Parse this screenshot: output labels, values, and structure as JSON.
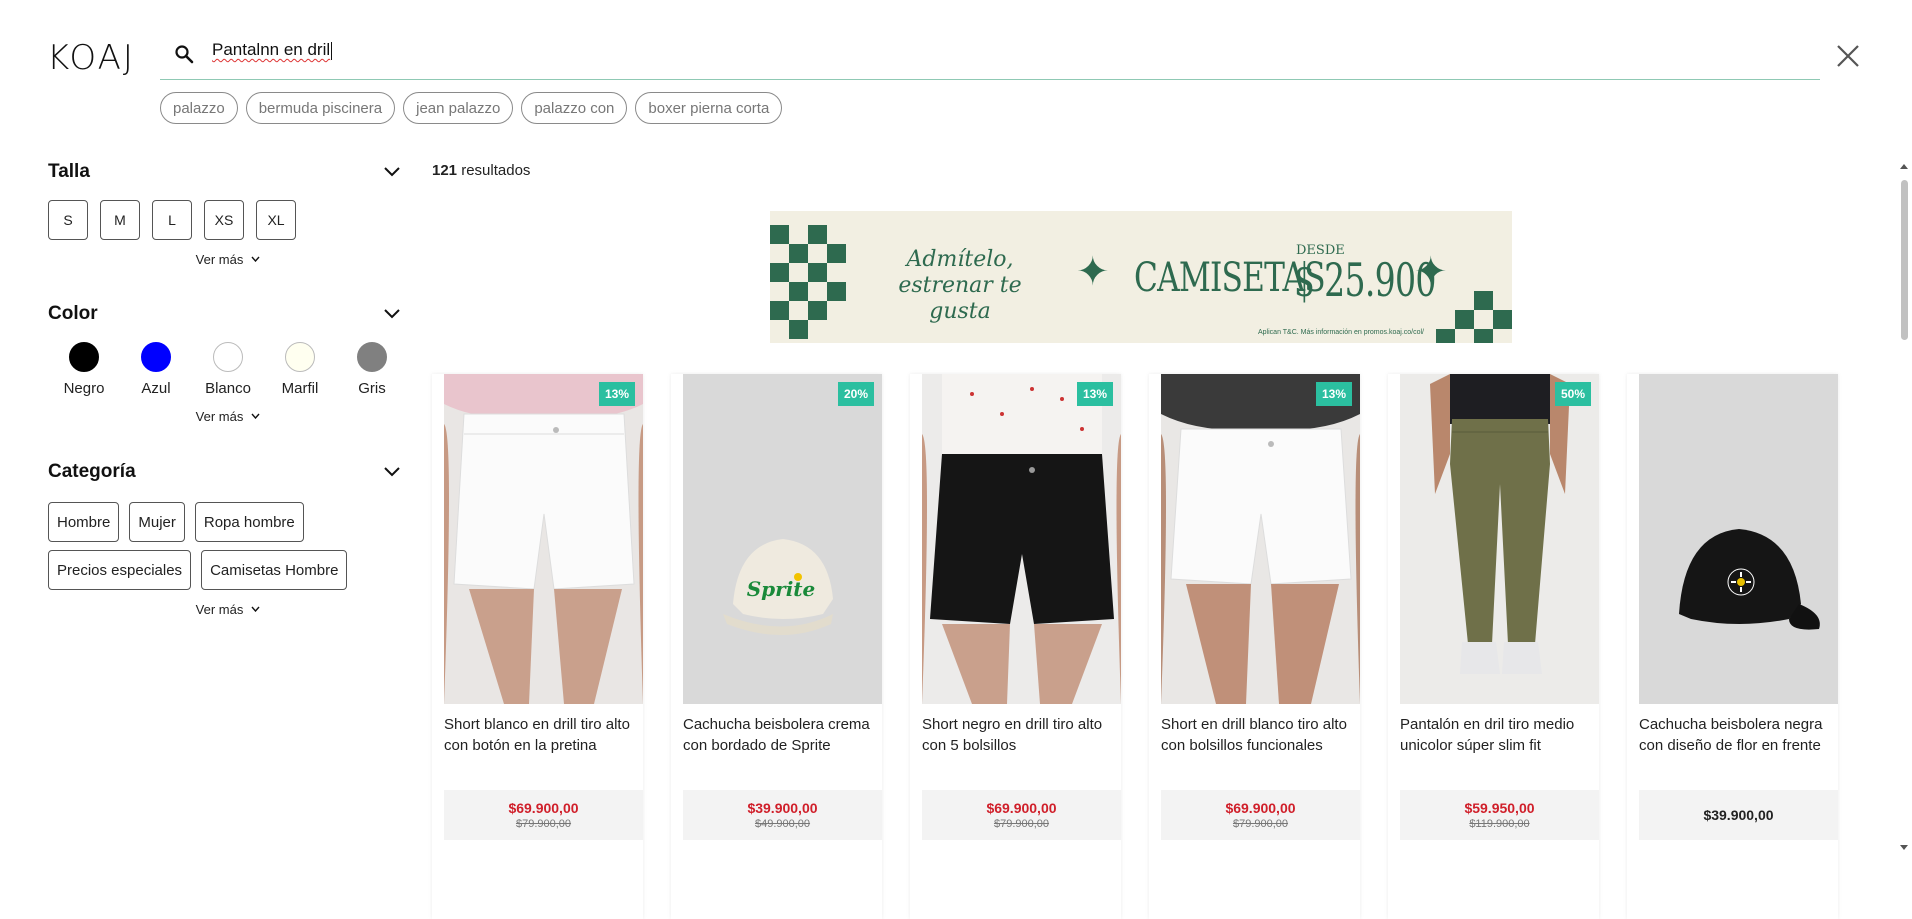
{
  "header": {
    "logo": "KOAJ",
    "search_value": "Pantalnn en dril",
    "suggestions": [
      "palazzo",
      "bermuda piscinera",
      "jean palazzo",
      "palazzo con",
      "boxer pierna corta"
    ]
  },
  "filters": {
    "talla": {
      "title": "Talla",
      "options": [
        "S",
        "M",
        "L",
        "XS",
        "XL"
      ],
      "more": "Ver más"
    },
    "color": {
      "title": "Color",
      "options": [
        {
          "label": "Negro",
          "hex": "#000000"
        },
        {
          "label": "Azul",
          "hex": "#0000ff"
        },
        {
          "label": "Blanco",
          "hex": "#ffffff"
        },
        {
          "label": "Marfil",
          "hex": "#fffff0"
        },
        {
          "label": "Gris",
          "hex": "#808080"
        }
      ],
      "more": "Ver más"
    },
    "categoria": {
      "title": "Categoría",
      "options": [
        "Hombre",
        "Mujer",
        "Ropa hombre",
        "Precios especiales",
        "Camisetas Hombre"
      ],
      "more": "Ver más"
    }
  },
  "results": {
    "count": "121",
    "label": "resultados"
  },
  "banner": {
    "line1": "Admítelo,",
    "line2": "estrenar te gusta",
    "product": "CAMISETAS",
    "from": "DESDE",
    "price": "$ 25.900",
    "legal": "Aplican T&C. Más información en promos.koaj.co/col/",
    "color": "#2e6a4f"
  },
  "products": [
    {
      "name": "Short blanco en drill tiro alto con botón en la pretina",
      "discount": "13%",
      "price": "$69.900,00",
      "old_price": "$79.900,00",
      "type": "white-shorts"
    },
    {
      "name": "Cachucha beisbolera crema con bordado de Sprite",
      "discount": "20%",
      "price": "$39.900,00",
      "old_price": "$49.900,00",
      "type": "cream-cap"
    },
    {
      "name": "Short negro en drill tiro alto con 5 bolsillos",
      "discount": "13%",
      "price": "$69.900,00",
      "old_price": "$79.900,00",
      "type": "black-shorts"
    },
    {
      "name": "Short en drill blanco tiro alto con bolsillos funcionales",
      "discount": "13%",
      "price": "$69.900,00",
      "old_price": "$79.900,00",
      "type": "white-shorts-2"
    },
    {
      "name": "Pantalón en dril tiro medio unicolor súper slim fit",
      "discount": "50%",
      "price": "$59.950,00",
      "old_price": "$119.900,00",
      "type": "olive-pants"
    },
    {
      "name": "Cachucha beisbolera negra con diseño de flor en frente",
      "discount": "",
      "price": "$39.900,00",
      "old_price": "",
      "type": "black-cap"
    }
  ],
  "colors": {
    "accent_line": "#8fc9b4",
    "discount_badge": "#2bbfa0",
    "sale_price": "#d01f2a"
  }
}
